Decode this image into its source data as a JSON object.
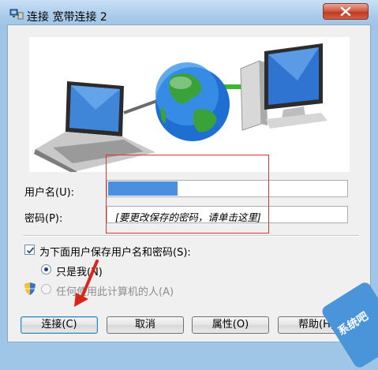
{
  "window": {
    "title": "连接 宽带连接 2"
  },
  "form": {
    "username_label": "用户名(U):",
    "username_value": "",
    "password_label": "密码(P):",
    "password_hint": "[要更改保存的密码，请单击这里]",
    "save_checkbox_label": "为下面用户保存用户名和密码(S):",
    "save_checked": true,
    "radio_only_me": "只是我(N)",
    "radio_anyone": "任何使用此计算机的人(A)",
    "selected_radio": "only_me"
  },
  "buttons": {
    "connect": "连接(C)",
    "cancel": "取消",
    "properties": "属性(O)",
    "help": "帮助(H)"
  },
  "watermark": {
    "text": "系统吧"
  },
  "colors": {
    "title_gradient": "#a9cbea",
    "close_red": "#c8452c",
    "annotation_red": "#dd3333",
    "username_highlight": "#4a8fe0"
  },
  "icons": [
    "network-connection-icon",
    "close-icon",
    "laptop-icon",
    "globe-icon",
    "desktop-computer-icon",
    "shield-icon",
    "red-arrow-annotation"
  ]
}
